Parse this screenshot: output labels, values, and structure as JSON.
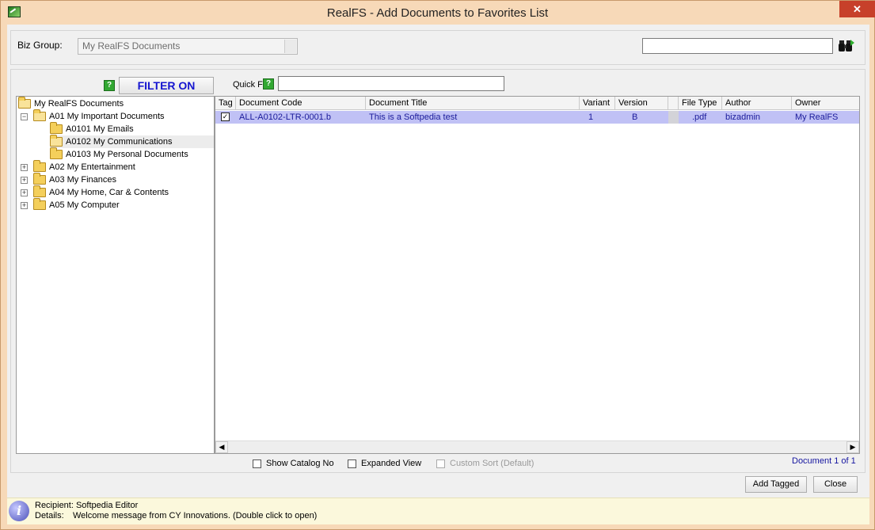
{
  "window": {
    "title": "RealFS - Add Documents to Favorites List",
    "close_glyph": "✕"
  },
  "topbar": {
    "biz_group_label": "Biz Group:",
    "biz_group_value": "My RealFS Documents",
    "search_value": ""
  },
  "filter": {
    "filter_label": "FILTER ON",
    "quick_filter_label": "Quick Fi",
    "help_glyph": "?",
    "quick_filter_value": ""
  },
  "tree": {
    "root": "My RealFS Documents",
    "items": [
      {
        "label": "A01 My Important Documents",
        "expander": "−"
      },
      {
        "label": "A0101 My Emails"
      },
      {
        "label": "A0102 My Communications"
      },
      {
        "label": "A0103 My Personal Documents"
      },
      {
        "label": "A02 My Entertainment",
        "expander": "+"
      },
      {
        "label": "A03 My Finances",
        "expander": "+"
      },
      {
        "label": "A04 My Home, Car & Contents",
        "expander": "+"
      },
      {
        "label": "A05 My Computer",
        "expander": "+"
      }
    ]
  },
  "grid": {
    "columns": [
      "Tag",
      "Document Code",
      "Document Title",
      "Variant",
      "Version",
      "",
      "File Type",
      "Author",
      "Owner"
    ],
    "rows": [
      {
        "tag": "✓",
        "code": "ALL-A0102-LTR-0001.b",
        "title": "This is a Softpedia test",
        "variant": "1",
        "version": "B",
        "file_type": ".pdf",
        "author": "bizadmin",
        "owner": "My RealFS"
      }
    ],
    "scroll_left": "◀",
    "scroll_right": "▶"
  },
  "options": {
    "show_catalog": "Show Catalog No",
    "expanded_view": "Expanded View",
    "custom_sort": "Custom Sort (Default)"
  },
  "doc_count": "Document 1 of 1",
  "buttons": {
    "add_tagged": "Add Tagged",
    "close": "Close"
  },
  "status": {
    "recipient": "Recipient: Softpedia Editor",
    "details_label": "Details:",
    "details": "Welcome message from CY Innovations. (Double click to open)",
    "info_glyph": "i"
  },
  "colors": {
    "selected_row": "#c0c1f5",
    "filter_text": "#1515d0",
    "title_bar": "#f7d9b8"
  }
}
